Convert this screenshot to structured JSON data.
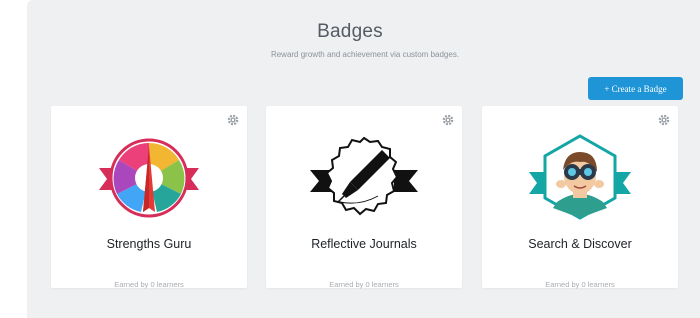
{
  "header": {
    "title": "Badges",
    "subtitle": "Reward growth and achievement via custom badges."
  },
  "actions": {
    "create_label": "+ Create a Badge"
  },
  "colors": {
    "accent": "#1f95d8",
    "panel_bg": "#eef0f2",
    "ribbon_red": "#d62e59",
    "teal": "#14a5a5"
  },
  "badges": [
    {
      "name": "Strengths Guru",
      "earned": "Earned by 0 learners",
      "icon": "compass-badge-icon"
    },
    {
      "name": "Reflective Journals",
      "earned": "Earned by 0 learners",
      "icon": "fountain-pen-badge-icon"
    },
    {
      "name": "Search & Discover",
      "earned": "Earned by 0 learners",
      "icon": "explorer-binoculars-badge-icon"
    }
  ]
}
